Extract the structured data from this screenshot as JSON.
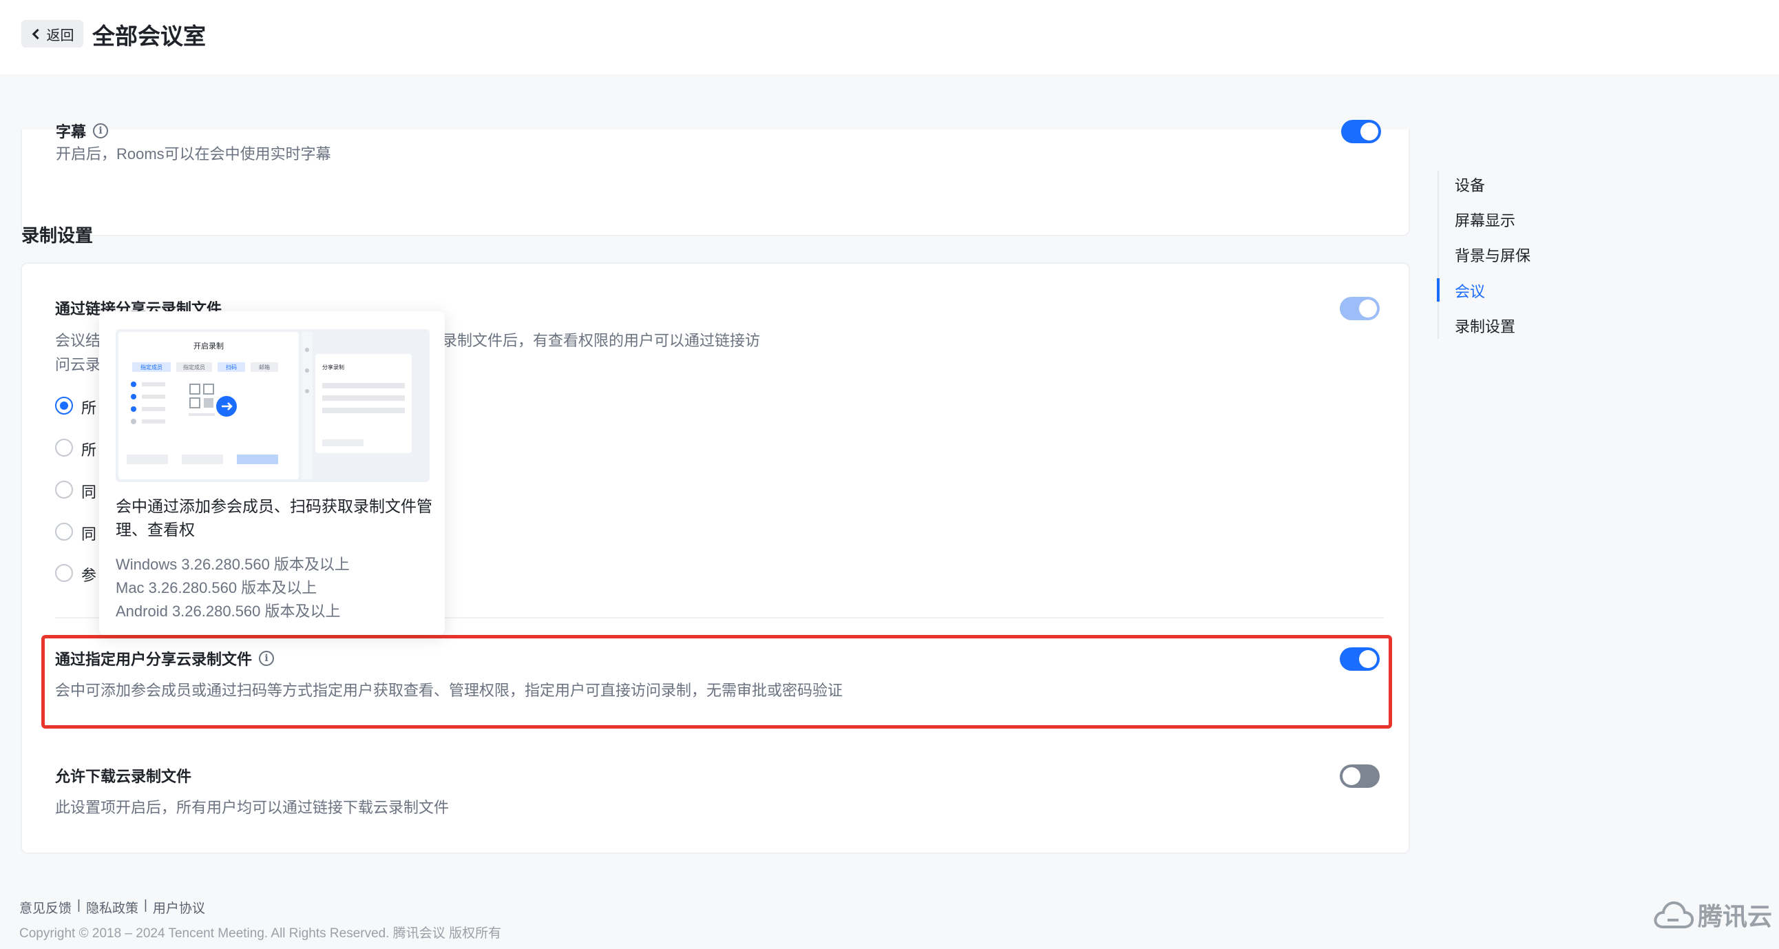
{
  "header": {
    "back_label": "返回",
    "title": "全部会议室"
  },
  "top_setting": {
    "title": "字幕",
    "desc": "开启后，Rooms可以在会中使用实时字幕",
    "toggle_on": true
  },
  "recording": {
    "heading": "录制设置",
    "share_link": {
      "title": "通过链接分享云录制文件",
      "desc_left_1": "会议结",
      "desc_right_1": "录制文件后，有查看权限的用户可以通过链接访",
      "desc_left_2": "问云录",
      "toggle_on": true,
      "options": [
        {
          "label": "所",
          "checked": true
        },
        {
          "label": "所",
          "checked": false
        },
        {
          "label": "同",
          "checked": false
        },
        {
          "label": "同",
          "checked": false
        },
        {
          "label": "参",
          "checked": false
        }
      ]
    },
    "specified_user": {
      "title": "通过指定用户分享云录制文件",
      "desc": "会中可添加参会成员或通过扫码等方式指定用户获取查看、管理权限，指定用户可直接访问录制，无需审批或密码验证",
      "toggle_on": true
    },
    "allow_download": {
      "title": "允许下载云录制文件",
      "desc": "此设置项开启后，所有用户均可以通过链接下载云录制文件",
      "toggle_on": false
    }
  },
  "popover": {
    "image": {
      "dialog_title": "开启录制",
      "tabs": [
        "指定成员",
        "指定成员",
        "扫码",
        "邮箱"
      ],
      "side_title": "分享录制"
    },
    "title": "会中通过添加参会成员、扫码获取录制文件管理、查看权",
    "versions": [
      "Windows 3.26.280.560 版本及以上",
      "Mac 3.26.280.560 版本及以上",
      "Android 3.26.280.560 版本及以上"
    ]
  },
  "right_nav": {
    "items": [
      {
        "label": "设备",
        "active": false
      },
      {
        "label": "屏幕显示",
        "active": false
      },
      {
        "label": "背景与屏保",
        "active": false
      },
      {
        "label": "会议",
        "active": true
      },
      {
        "label": "录制设置",
        "active": false
      }
    ]
  },
  "footer": {
    "links": [
      "意见反馈",
      "隐私政策",
      "用户协议"
    ],
    "separator": "|",
    "copyright": "Copyright © 2018 – 2024 Tencent Meeting. All Rights Reserved. 腾讯会议 版权所有",
    "brand": "腾讯云"
  },
  "colors": {
    "accent": "#1a6dff",
    "highlight": "#e8352c"
  }
}
